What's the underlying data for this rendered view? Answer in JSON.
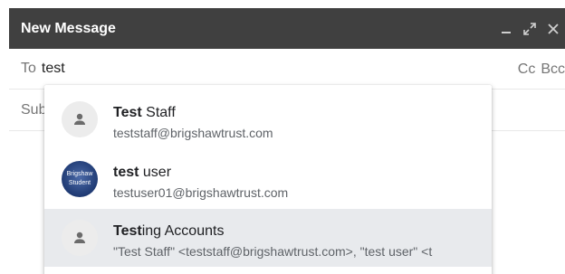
{
  "header": {
    "title": "New Message",
    "minimize_icon": "minimize-icon",
    "expand_icon": "expand-icon",
    "close_icon": "close-icon"
  },
  "to": {
    "label": "To",
    "value": "test",
    "cc_label": "Cc",
    "bcc_label": "Bcc"
  },
  "subject": {
    "label_visible": "Sub"
  },
  "suggestions": [
    {
      "name_bold": "Test",
      "name_rest": " Staff",
      "email": "teststaff@brigshawtrust.com",
      "avatar": "person-icon"
    },
    {
      "name_bold": "test",
      "name_rest": " user",
      "email": "testuser01@brigshawtrust.com",
      "avatar": "photo",
      "avatar_text1": "Brigshaw",
      "avatar_text2": "Student"
    },
    {
      "name_bold": "Test",
      "name_rest": "ing Accounts",
      "email": "\"Test Staff\" <teststaff@brigshawtrust.com>, \"test user\" <t",
      "avatar": "person-icon"
    }
  ]
}
